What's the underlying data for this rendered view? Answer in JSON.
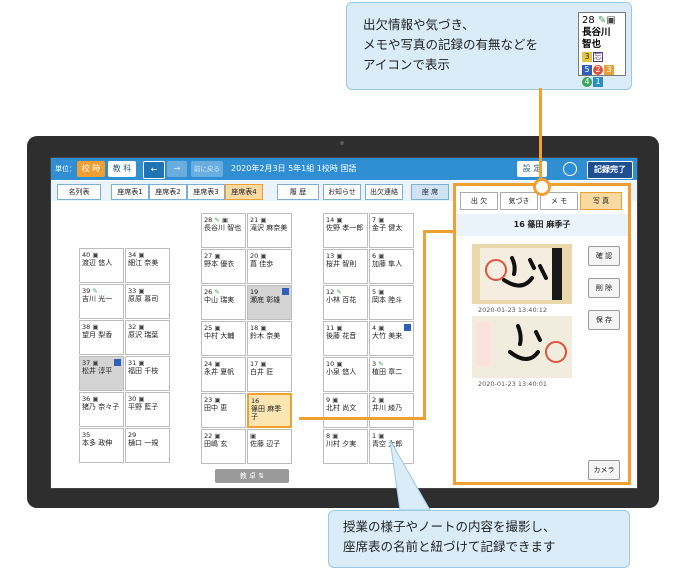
{
  "callouts": {
    "top": {
      "line1": "出欠情報や気づき、",
      "line2": "メモや写真の記録の有無などを",
      "line3": "アイコンで表示"
    },
    "bottom": {
      "line1": "授業の様子やノートの内容を撮影し、",
      "line2": "座席表の名前と紐づけて記録できます"
    }
  },
  "legend_card": {
    "number": "28",
    "name": "長谷川 智也",
    "badges_row1": [
      "3",
      "忘"
    ],
    "badges_row2": [
      "5",
      "2",
      "3",
      "4",
      "1"
    ]
  },
  "toolbar": {
    "unit_label": "単位：",
    "school_label": "校 時",
    "subject_label": "教 科",
    "back_label": "←",
    "forward_label": "→",
    "prev_label": "前に戻る",
    "session_title": "2020年2月3日 5年1組 1校時 国語",
    "settings_label": "設 定",
    "done_label": "記録完了"
  },
  "subbar": {
    "roster_label": "名列表",
    "seat_tabs": [
      "座席表1",
      "座席表2",
      "座席表3",
      "座席表4"
    ],
    "history_label": "履 歴",
    "notice_label": "お知らせ",
    "attendance_label": "出欠連絡",
    "seat_label": "座 席"
  },
  "seats": {
    "left1": [
      {
        "num": "40",
        "name": "渡辺 悠人"
      },
      {
        "num": "39",
        "name": "吉川 光一"
      },
      {
        "num": "38",
        "name": "望月 梨香"
      },
      {
        "num": "37",
        "name": "松井 淳平"
      },
      {
        "num": "36",
        "name": "猪乃 奈々子"
      },
      {
        "num": "35",
        "name": "本多 政伸"
      }
    ],
    "left2": [
      {
        "num": "34",
        "name": "細江 奈美"
      },
      {
        "num": "33",
        "name": "原原 慕司"
      },
      {
        "num": "32",
        "name": "原沢 瑞葉"
      },
      {
        "num": "31",
        "name": "福田 千枝"
      },
      {
        "num": "30",
        "name": "平野 藍子"
      },
      {
        "num": "29",
        "name": "樋口 一規"
      }
    ],
    "mid1": [
      {
        "num": "28",
        "name": "長谷川 智也"
      },
      {
        "num": "27",
        "name": "野本 優衣"
      },
      {
        "num": "26",
        "name": "中山 瑞実"
      },
      {
        "num": "25",
        "name": "中村 大輔"
      },
      {
        "num": "24",
        "name": "永井 夏帆"
      },
      {
        "num": "23",
        "name": "田中 恵"
      },
      {
        "num": "22",
        "name": "田嶋 玄"
      }
    ],
    "mid2": [
      {
        "num": "21",
        "name": "滝沢 麻奈美"
      },
      {
        "num": "20",
        "name": "菖 佳歩"
      },
      {
        "num": "19",
        "name": "瀬底 彰雄"
      },
      {
        "num": "18",
        "name": "鈴木 奈美"
      },
      {
        "num": "17",
        "name": "白井 匠"
      },
      {
        "num": "16",
        "name": "篠田 麻季子"
      },
      {
        "num": "",
        "name": "佐藤 辺子"
      }
    ],
    "right1": [
      {
        "num": "14",
        "name": "佐野 孝一郎"
      },
      {
        "num": "13",
        "name": "桜井 智則"
      },
      {
        "num": "12",
        "name": "小林 百花"
      },
      {
        "num": "11",
        "name": "後藤 花音"
      },
      {
        "num": "10",
        "name": "小泉 悠人"
      },
      {
        "num": "9",
        "name": "北村 尚文"
      },
      {
        "num": "8",
        "name": "川村 夕実"
      }
    ],
    "right2": [
      {
        "num": "7",
        "name": "金子 健太"
      },
      {
        "num": "6",
        "name": "加藤 隼人"
      },
      {
        "num": "5",
        "name": "岡本 陸斗"
      },
      {
        "num": "4",
        "name": "大竹 美来"
      },
      {
        "num": "3",
        "name": "植田 章二"
      },
      {
        "num": "2",
        "name": "井川 綾乃"
      },
      {
        "num": "1",
        "name": "青空 太郎"
      }
    ]
  },
  "scroll_label": "教 卓 ⇅",
  "panel": {
    "tabs": [
      "出 欠",
      "気づき",
      "メ モ",
      "写 真"
    ],
    "student": "16 篠田 麻季子",
    "photos": [
      {
        "timestamp": "2020-01-23 13:40:12"
      },
      {
        "timestamp": "2020-01-23 13:40:01"
      }
    ],
    "buttons": [
      "確 認",
      "削 除",
      "保 存"
    ],
    "camera_label": "カメラ"
  },
  "colors": {
    "accent_orange": "#f0a032",
    "toolbar_blue": "#2f8fd2",
    "callout_bg": "#d9ecf8"
  }
}
